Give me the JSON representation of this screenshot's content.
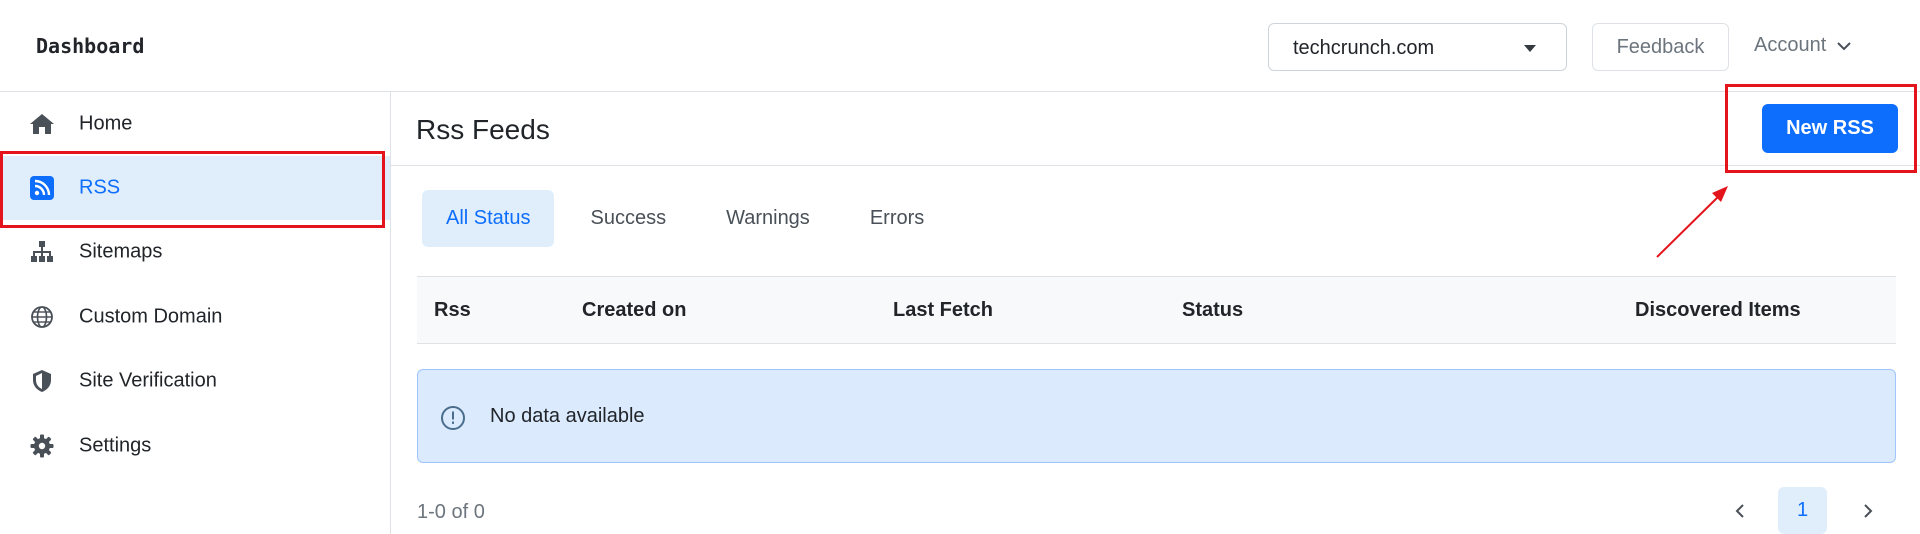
{
  "header": {
    "brand": "Dashboard",
    "site_select_value": "techcrunch.com",
    "feedback_label": "Feedback",
    "account_label": "Account"
  },
  "sidebar": {
    "items": [
      {
        "label": "Home",
        "icon": "home-icon"
      },
      {
        "label": "RSS",
        "icon": "rss-icon",
        "active": true
      },
      {
        "label": "Sitemaps",
        "icon": "sitemap-icon"
      },
      {
        "label": "Custom Domain",
        "icon": "globe-icon"
      },
      {
        "label": "Site Verification",
        "icon": "shield-icon"
      },
      {
        "label": "Settings",
        "icon": "gear-icon"
      }
    ]
  },
  "main": {
    "title": "Rss Feeds",
    "new_button_label": "New RSS",
    "tabs": [
      {
        "label": "All Status",
        "active": true
      },
      {
        "label": "Success"
      },
      {
        "label": "Warnings"
      },
      {
        "label": "Errors"
      }
    ],
    "table": {
      "columns": [
        "Rss",
        "Created on",
        "Last Fetch",
        "Status",
        "Discovered Items"
      ],
      "empty_message": "No data available"
    },
    "pagination": {
      "range_text": "1-0 of 0",
      "current_page": "1"
    }
  },
  "colors": {
    "accent": "#0d6efd",
    "active_bg": "#e0eefc",
    "highlight": "#e3141b",
    "alert_bg": "#dbeafd"
  }
}
